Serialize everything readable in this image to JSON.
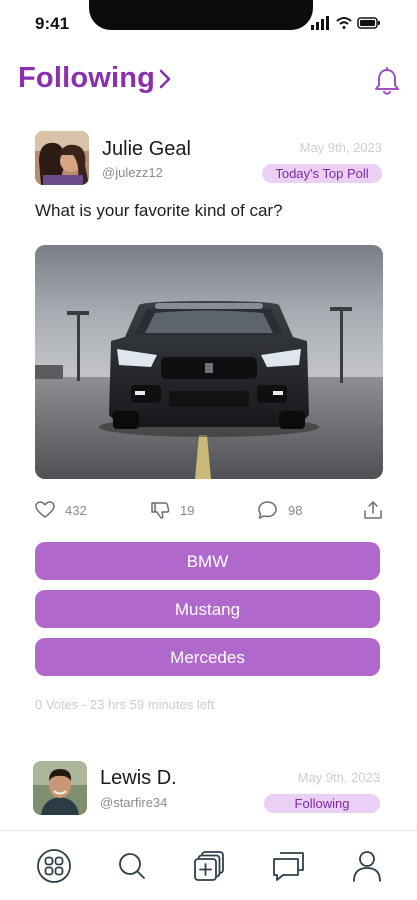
{
  "status_bar": {
    "time": "9:41"
  },
  "header": {
    "title": "Following",
    "bell_icon": "bell-icon",
    "chevron_icon": "chevron-right-icon"
  },
  "colors": {
    "accent": "#8a2fb0",
    "option_bg": "#b168cc",
    "pill_bg": "#eccff5"
  },
  "post": {
    "author_name": "Julie Geal",
    "author_handle": "@julezz12",
    "date": "May 9th, 2023",
    "badge": "Today's Top Poll",
    "question": "What is your favorite kind of car?",
    "image_icon": "car-photo",
    "actions": {
      "likes": "432",
      "dislikes": "19",
      "comments": "98"
    },
    "options": [
      "BMW",
      "Mustang",
      "Mercedes"
    ],
    "meta": "0 Votes - 23 hrs 59 minutes left"
  },
  "next_post": {
    "author_name": "Lewis D.",
    "author_handle": "@starfire34",
    "date": "May 9th, 2023",
    "badge": "Following"
  },
  "bottom_nav": {
    "items": [
      "home-grid-icon",
      "search-icon",
      "add-poll-icon",
      "messages-icon",
      "profile-icon"
    ]
  }
}
